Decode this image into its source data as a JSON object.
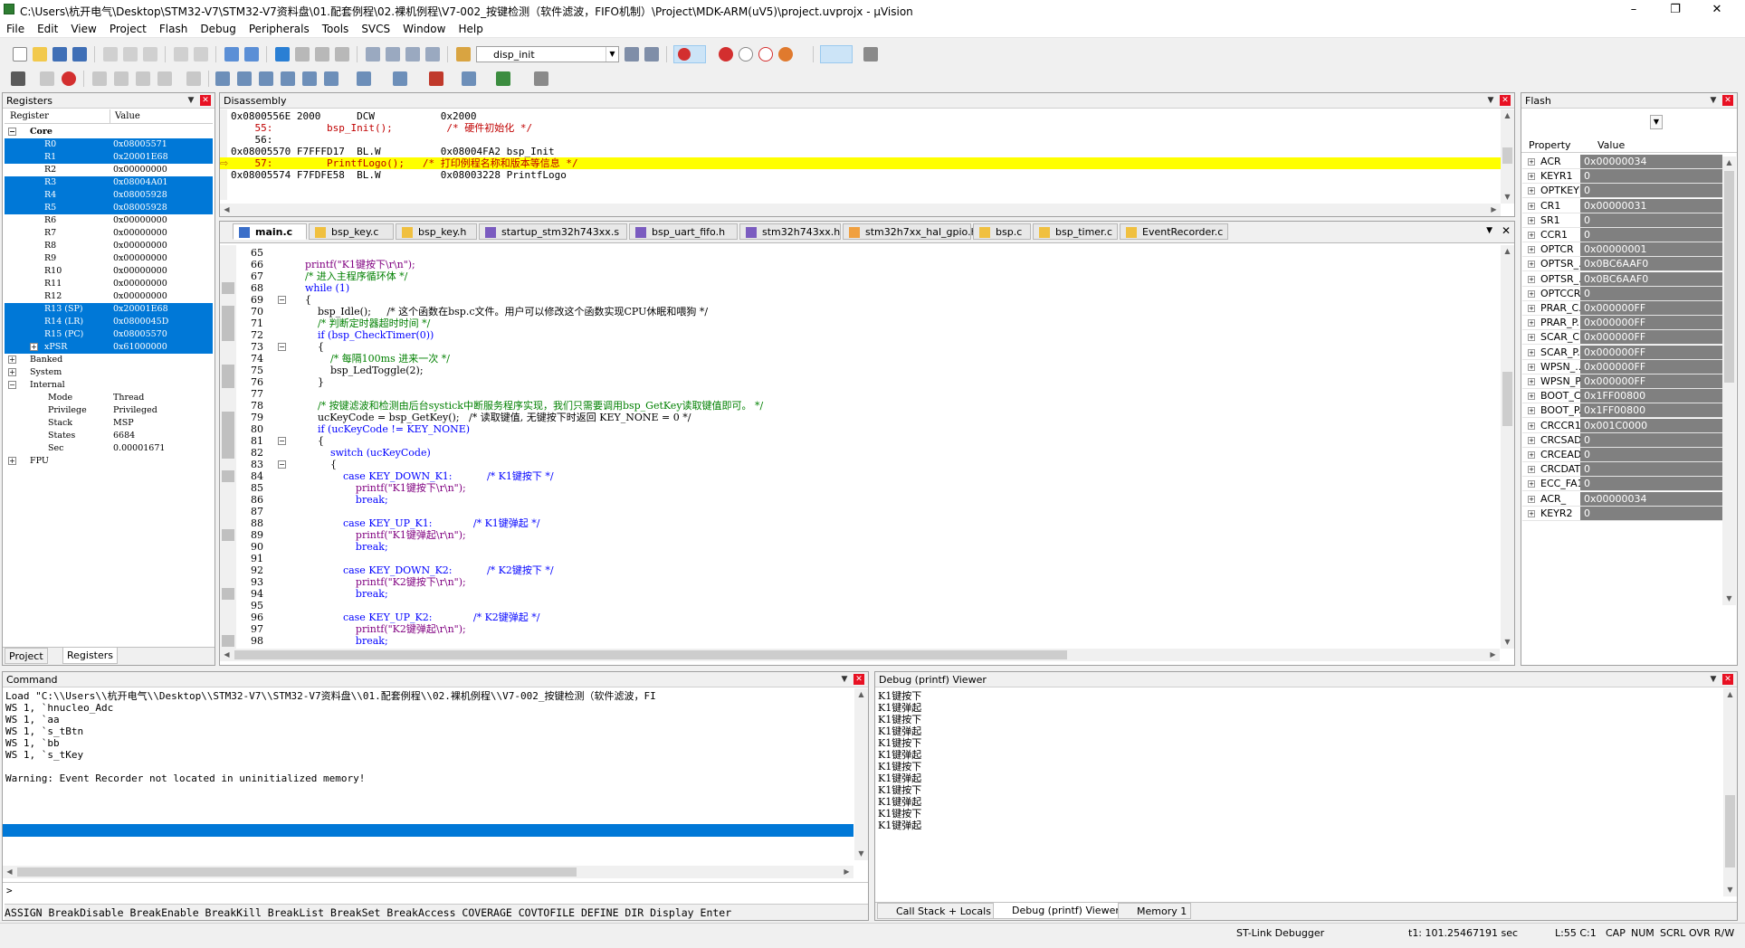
{
  "window": {
    "title": "C:\\Users\\杭开电气\\Desktop\\STM32-V7\\STM32-V7资料盘\\01.配套例程\\02.裸机例程\\V7-002_按键检测（软件滤波，FIFO机制）\\Project\\MDK-ARM(uV5)\\project.uvprojx - µVision",
    "minimize": "–",
    "maximize": "❐",
    "close": "✕"
  },
  "menu": [
    "File",
    "Edit",
    "View",
    "Project",
    "Flash",
    "Debug",
    "Peripherals",
    "Tools",
    "SVCS",
    "Window",
    "Help"
  ],
  "toolbar": {
    "target_combo": "disp_init"
  },
  "registers": {
    "title": "Registers",
    "col_register": "Register",
    "col_value": "Value",
    "core_label": "Core",
    "core": [
      {
        "name": "R0",
        "value": "0x08005571",
        "sel": true
      },
      {
        "name": "R1",
        "value": "0x20001E68",
        "sel": true
      },
      {
        "name": "R2",
        "value": "0x00000000",
        "sel": false
      },
      {
        "name": "R3",
        "value": "0x08004A01",
        "sel": true
      },
      {
        "name": "R4",
        "value": "0x08005928",
        "sel": true
      },
      {
        "name": "R5",
        "value": "0x08005928",
        "sel": true
      },
      {
        "name": "R6",
        "value": "0x00000000",
        "sel": false
      },
      {
        "name": "R7",
        "value": "0x00000000",
        "sel": false
      },
      {
        "name": "R8",
        "value": "0x00000000",
        "sel": false
      },
      {
        "name": "R9",
        "value": "0x00000000",
        "sel": false
      },
      {
        "name": "R10",
        "value": "0x00000000",
        "sel": false
      },
      {
        "name": "R11",
        "value": "0x00000000",
        "sel": false
      },
      {
        "name": "R12",
        "value": "0x00000000",
        "sel": false
      },
      {
        "name": "R13 (SP)",
        "value": "0x20001E68",
        "sel": true
      },
      {
        "name": "R14 (LR)",
        "value": "0x0800045D",
        "sel": true
      },
      {
        "name": "R15 (PC)",
        "value": "0x08005570",
        "sel": true
      },
      {
        "name": "xPSR",
        "value": "0x61000000",
        "sel": true
      }
    ],
    "groups": [
      "Banked",
      "System",
      "Internal"
    ],
    "internal": [
      {
        "name": "Mode",
        "value": "Thread"
      },
      {
        "name": "Privilege",
        "value": "Privileged"
      },
      {
        "name": "Stack",
        "value": "MSP"
      },
      {
        "name": "States",
        "value": "6684"
      },
      {
        "name": "Sec",
        "value": "0.00001671"
      }
    ],
    "fpu": "FPU",
    "tabs": [
      "Project",
      "Registers"
    ]
  },
  "disassembly": {
    "title": "Disassembly",
    "lines": [
      "0x0800556E 2000      DCW           0x2000",
      "    55:         bsp_Init();         /* 硬件初始化 */",
      "    56:",
      "0x08005570 F7FFFD17  BL.W          0x08004FA2 bsp_Init",
      "    57:         PrintfLogo();   /* 打印例程名称和版本等信息 */",
      "0x08005574 F7FDFE58  BL.W          0x08003228 PrintfLogo"
    ]
  },
  "editor": {
    "tabs": [
      "main.c",
      "bsp_key.c",
      "bsp_key.h",
      "startup_stm32h743xx.s",
      "bsp_uart_fifo.h",
      "stm32h743xx.h",
      "stm32h7xx_hal_gpio.h",
      "bsp.c",
      "bsp_timer.c",
      "EventRecorder.c"
    ],
    "line_numbers": [
      "65",
      "66",
      "67",
      "68",
      "69",
      "70",
      "71",
      "72",
      "73",
      "74",
      "75",
      "76",
      "77",
      "78",
      "79",
      "80",
      "81",
      "82",
      "83",
      "84",
      "85",
      "86",
      "87",
      "88",
      "89",
      "90",
      "91",
      "92",
      "93",
      "94",
      "95",
      "96",
      "97",
      "98"
    ],
    "lines": [
      "",
      "    printf(\"K1键按下\\r\\n\");",
      "    /* 进入主程序循环体 */",
      "    while (1)",
      "    {",
      "        bsp_Idle();     /* 这个函数在bsp.c文件。用户可以修改这个函数实现CPU休眠和喂狗 */",
      "        /* 判断定时器超时时间 */",
      "        if (bsp_CheckTimer(0))",
      "        {",
      "            /* 每隔100ms 进来一次 */",
      "            bsp_LedToggle(2);",
      "        }",
      "",
      "        /* 按键滤波和检测由后台systick中断服务程序实现，我们只需要调用bsp_GetKey读取键值即可。 */",
      "        ucKeyCode = bsp_GetKey();   /* 读取键值, 无键按下时返回 KEY_NONE = 0 */",
      "        if (ucKeyCode != KEY_NONE)",
      "        {",
      "            switch (ucKeyCode)",
      "            {",
      "                case KEY_DOWN_K1:           /* K1键按下 */",
      "                    printf(\"K1键按下\\r\\n\");",
      "                    break;",
      "",
      "                case KEY_UP_K1:             /* K1键弹起 */",
      "                    printf(\"K1键弹起\\r\\n\");",
      "                    break;",
      "",
      "                case KEY_DOWN_K2:           /* K2键按下 */",
      "                    printf(\"K2键按下\\r\\n\");",
      "                    break;",
      "",
      "                case KEY_UP_K2:             /* K2键弹起 */",
      "                    printf(\"K2键弹起\\r\\n\");",
      "                    break;"
    ]
  },
  "flash": {
    "title": "Flash",
    "col_property": "Property",
    "col_value": "Value",
    "rows": [
      {
        "name": "ACR",
        "value": "0x00000034"
      },
      {
        "name": "KEYR1",
        "value": "0"
      },
      {
        "name": "OPTKEYR",
        "value": "0"
      },
      {
        "name": "CR1",
        "value": "0x00000031"
      },
      {
        "name": "SR1",
        "value": "0"
      },
      {
        "name": "CCR1",
        "value": "0"
      },
      {
        "name": "OPTCR",
        "value": "0x00000001"
      },
      {
        "name": "OPTSR_...",
        "value": "0x0BC6AAF0"
      },
      {
        "name": "OPTSR_...",
        "value": "0x0BC6AAF0"
      },
      {
        "name": "OPTCCR",
        "value": "0"
      },
      {
        "name": "PRAR_C...",
        "value": "0x000000FF"
      },
      {
        "name": "PRAR_P...",
        "value": "0x000000FF"
      },
      {
        "name": "SCAR_C...",
        "value": "0x000000FF"
      },
      {
        "name": "SCAR_P...",
        "value": "0x000000FF"
      },
      {
        "name": "WPSN_...",
        "value": "0x000000FF"
      },
      {
        "name": "WPSN_P...",
        "value": "0x000000FF"
      },
      {
        "name": "BOOT_C...",
        "value": "0x1FF00800"
      },
      {
        "name": "BOOT_P...",
        "value": "0x1FF00800"
      },
      {
        "name": "CRCCR1",
        "value": "0x001C0000"
      },
      {
        "name": "CRCSAD...",
        "value": "0"
      },
      {
        "name": "CRCEAD...",
        "value": "0"
      },
      {
        "name": "CRCDAT...",
        "value": "0"
      },
      {
        "name": "ECC_FA1R",
        "value": "0"
      },
      {
        "name": "ACR_",
        "value": "0x00000034"
      },
      {
        "name": "KEYR2",
        "value": "0"
      }
    ]
  },
  "command": {
    "title": "Command",
    "lines": [
      "Load \"C:\\\\Users\\\\杭开电气\\\\Desktop\\\\STM32-V7\\\\STM32-V7资料盘\\\\01.配套例程\\\\02.裸机例程\\\\V7-002_按键检测（软件滤波，FI",
      "WS 1, `hnucleo_Adc",
      "WS 1, `aa",
      "WS 1, `s_tBtn",
      "WS 1, `bb",
      "WS 1, `s_tKey",
      "",
      "Warning: Event Recorder not located in uninitialized memory!"
    ],
    "prompt": ">",
    "autocomplete": "ASSIGN BreakDisable BreakEnable BreakKill BreakList BreakSet BreakAccess COVERAGE COVTOFILE DEFINE DIR Display Enter"
  },
  "debug_viewer": {
    "title": "Debug (printf) Viewer",
    "lines": [
      "K1键按下",
      "K1键弹起",
      "K1键按下",
      "K1键弹起",
      "K1键按下",
      "K1键弹起",
      "K1键按下",
      "K1键弹起",
      "K1键按下",
      "K1键弹起",
      "K1键按下",
      "K1键弹起"
    ],
    "tabs": [
      "Call Stack + Locals",
      "Debug (printf) Viewer",
      "Memory 1"
    ]
  },
  "status": {
    "debugger": "ST-Link Debugger",
    "time": "t1: 101.25467191 sec",
    "position": "L:55 C:1",
    "caps": "CAP",
    "num": "NUM",
    "scrl": "SCRL",
    "ovr": "OVR",
    "rw": "R/W"
  }
}
